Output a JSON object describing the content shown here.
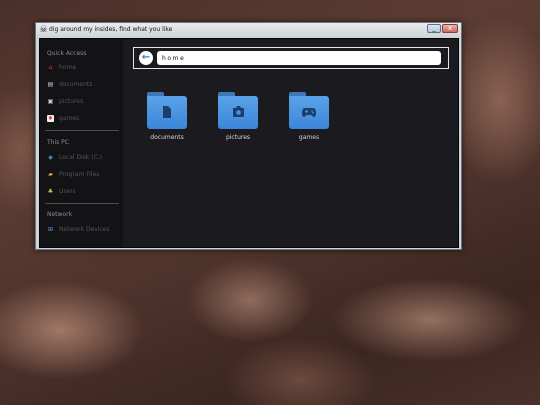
{
  "window": {
    "title": "dig around my insides, find what you like",
    "icon": "skull-crossbones-icon",
    "controls": {
      "minimize": "_",
      "close": "x"
    }
  },
  "sidebar": {
    "sections": [
      {
        "heading": "Quick Access",
        "items": [
          {
            "label": "home",
            "icon": "home-icon",
            "color": "#d93b3b"
          },
          {
            "label": "documents",
            "icon": "document-icon",
            "color": "#cfcfcf"
          },
          {
            "label": "pictures",
            "icon": "picture-icon",
            "color": "#cfcfcf"
          },
          {
            "label": "games",
            "icon": "game-icon",
            "color": "#d93b3b"
          }
        ]
      },
      {
        "heading": "This PC",
        "items": [
          {
            "label": "Local Disk (C:)",
            "icon": "disk-icon",
            "color": "#6aa7e6"
          },
          {
            "label": "Program Files",
            "icon": "folder-icon",
            "color": "#e0b25a"
          },
          {
            "label": "Users",
            "icon": "users-icon",
            "color": "#c9c34a"
          }
        ]
      },
      {
        "heading": "Network",
        "items": [
          {
            "label": "Network Devices",
            "icon": "network-icon",
            "color": "#5a9be0"
          }
        ]
      }
    ]
  },
  "address_bar": {
    "path": "home",
    "back_icon": "back-arrow-icon"
  },
  "folders": [
    {
      "label": "documents",
      "icon": "document-icon"
    },
    {
      "label": "pictures",
      "icon": "camera-icon"
    },
    {
      "label": "games",
      "icon": "gamepad-icon"
    }
  ]
}
